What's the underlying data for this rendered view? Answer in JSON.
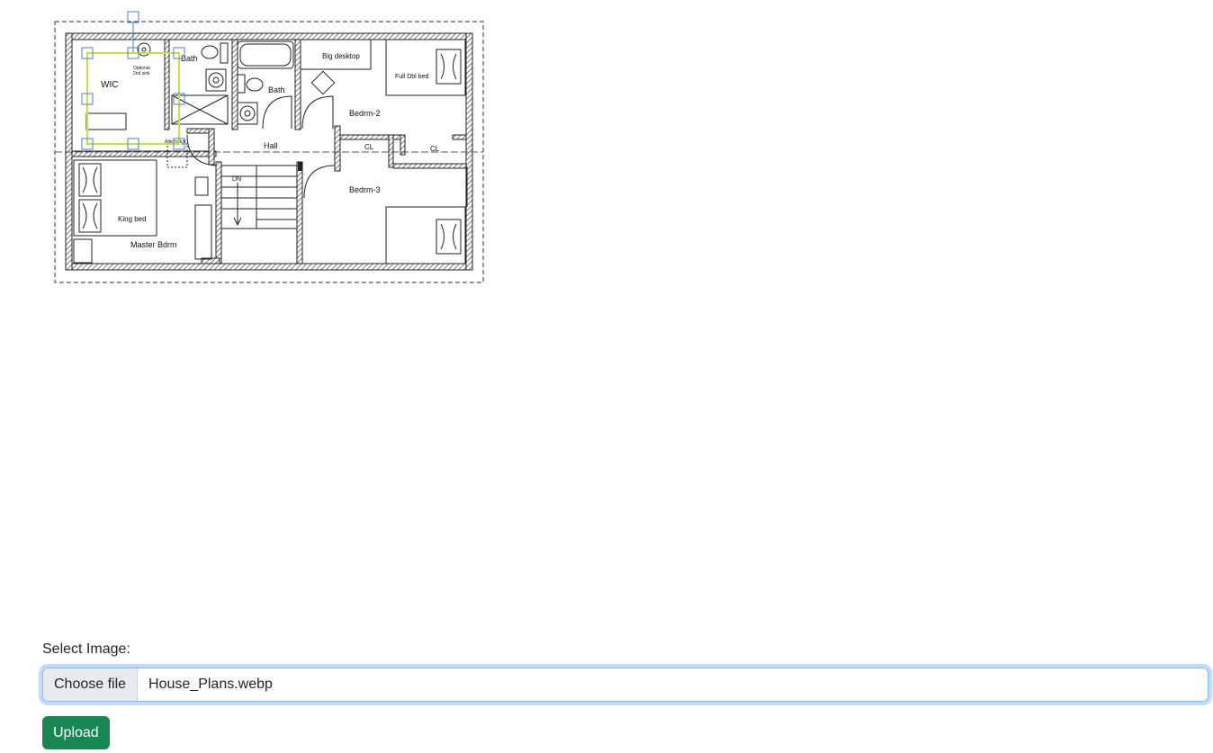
{
  "plan": {
    "labels": {
      "bath_top": "Bath",
      "bath_mid": "Bath",
      "wic": "WIC",
      "optional_sink_1": "Optional",
      "optional_sink_2": "2nd sink",
      "attic_hatch": "Attic hatch",
      "big_desktop": "Big desktop",
      "full_dbl_bed": "Full Dbl bed",
      "bedrm2": "Bedrm-2",
      "hall": "Hall",
      "cl1": "CL",
      "cl2": "CL",
      "dn": "DN",
      "bedrm3": "Bedrm-3",
      "king_bed": "King bed",
      "master_bdrm": "Master Bdrm"
    },
    "selection_color": "#c8e048",
    "handle_color": "#4a7fd4"
  },
  "form": {
    "label": "Select Image:",
    "choose_file": "Choose file",
    "file_name": "House_Plans.webp",
    "upload": "Upload"
  },
  "colors": {
    "upload_button": "#198754",
    "focus_border": "#86b7fe"
  }
}
